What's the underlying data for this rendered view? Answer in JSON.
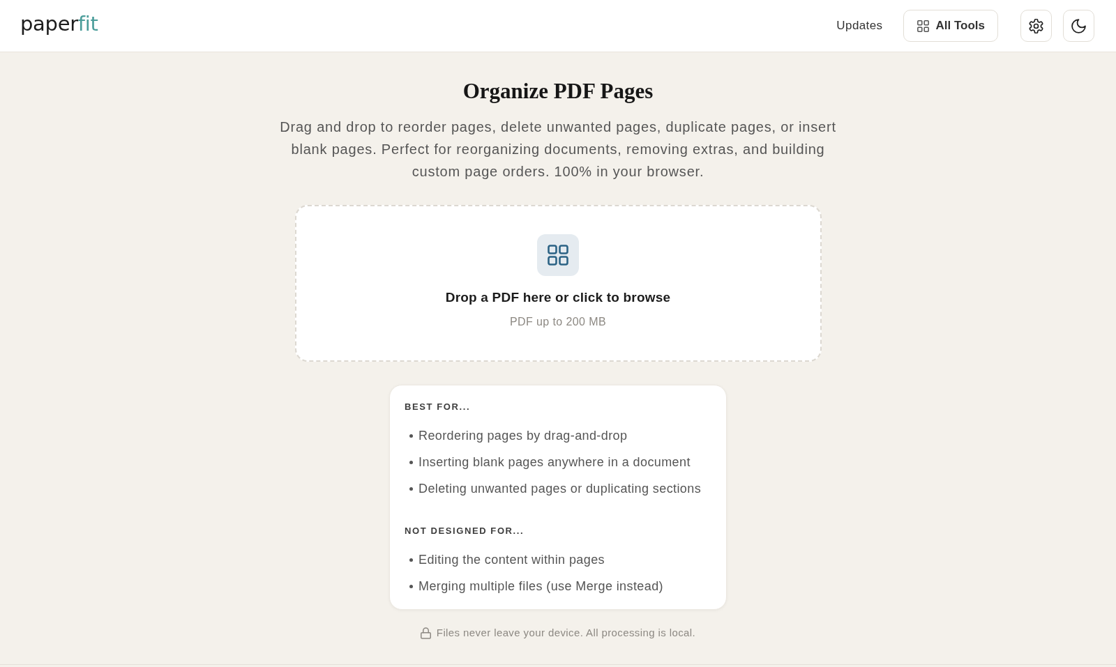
{
  "header": {
    "logo": {
      "text": "paper",
      "accent": "fit"
    },
    "links": [
      {
        "label": "Updates"
      }
    ],
    "tools_button": {
      "label": "All Tools"
    }
  },
  "page": {
    "title": "Organize PDF Pages",
    "description": "Drag and drop to reorder pages, delete unwanted pages, duplicate pages, or insert blank pages. Perfect for reorganizing documents, removing extras, and building custom page orders. 100% in your browser."
  },
  "drop_zone": {
    "title": "Drop a PDF here or click to browse",
    "hint": "PDF up to 200 MB"
  },
  "info_card": {
    "sections": [
      {
        "heading": "BEST FOR...",
        "items": [
          "Reordering pages by drag-and-drop",
          "Inserting blank pages anywhere in a document",
          "Deleting unwanted pages or duplicating sections"
        ]
      },
      {
        "heading": "NOT DESIGNED FOR...",
        "items": [
          "Editing the content within pages",
          "Merging multiple files (use Merge instead)"
        ]
      }
    ]
  },
  "privacy_note": "Files never leave your device. All processing is local."
}
